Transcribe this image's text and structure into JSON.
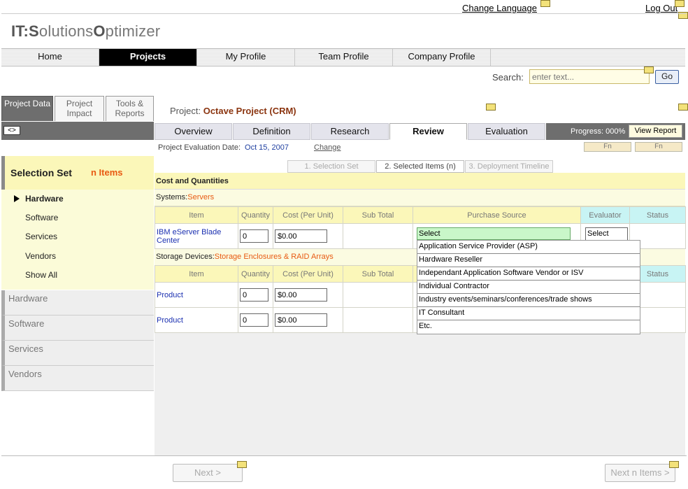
{
  "header": {
    "change_language": "Change Language",
    "logout": "Log Out",
    "logo": {
      "p1": "IT:",
      "p2": "S",
      "p3": "olutions",
      "p4": "O",
      "p5": "ptimizer"
    }
  },
  "main_nav": [
    "Home",
    "Projects",
    "My Profile",
    "Team Profile",
    "Company Profile"
  ],
  "search": {
    "label": "Search:",
    "placeholder": "enter text...",
    "button": "Go"
  },
  "left_tabs": {
    "project_data": "Project Data",
    "project_impact": "Project Impact",
    "tools_reports": "Tools & Reports",
    "toggle": "<>"
  },
  "selection_set": {
    "title": "Selection Set",
    "count": "n Items"
  },
  "categories": [
    "Hardware",
    "Software",
    "Services",
    "Vendors",
    "Show All"
  ],
  "accordion": [
    "Hardware",
    "Software",
    "Services",
    "Vendors"
  ],
  "project": {
    "label": "Project:",
    "name": "Octave Project (CRM)"
  },
  "sub_tabs": [
    "Overview",
    "Definition",
    "Research",
    "Review",
    "Evaluation"
  ],
  "progress": {
    "text": "Progress: 000%",
    "value": 0
  },
  "view_report": "View Report",
  "eval_date": {
    "label": "Project Evaluation Date:",
    "date": "Oct 15, 2007",
    "change": "Change"
  },
  "fn_buttons": [
    "Fn",
    "Fn"
  ],
  "step_tabs": [
    "1. Selection Set",
    "2. Selected Items (n)",
    "3. Deployment Timeline"
  ],
  "section_title": "Cost and Quantities",
  "columns": [
    "Item",
    "Quantity",
    "Cost (Per Unit)",
    "Sub Total",
    "Purchase Source",
    "Evaluator",
    "Status"
  ],
  "groups": [
    {
      "label": "Systems:",
      "type": "Servers"
    },
    {
      "label": "Storage Devices:",
      "type": "Storage Enclosures & RAID Arrays"
    }
  ],
  "rows": [
    {
      "item": "IBM eServer Blade Center",
      "qty": "0",
      "cost": "$0.00"
    },
    {
      "item": "Product",
      "qty": "0",
      "cost": "$0.00"
    },
    {
      "item": "Product",
      "qty": "0",
      "cost": "$0.00"
    }
  ],
  "purchase_source_selected": "Select",
  "evaluator_selected": "Select",
  "purchase_source_options": [
    "Application Service Provider (ASP)",
    "Hardware Reseller",
    "Independant Application Software Vendor or ISV",
    "Individual Contractor",
    "Industry events/seminars/conferences/trade shows",
    "IT Consultant",
    "Etc."
  ],
  "footer": {
    "next": "Next >",
    "next_items": "Next n Items >"
  },
  "colors": {
    "accent_orange": "#e85a12",
    "project_name": "#8b3510",
    "link_blue": "#1a2fb0",
    "yellow_bg": "#fbf7b9",
    "cyan_header": "#c8f4f4",
    "green_select": "#c9f7c9"
  }
}
